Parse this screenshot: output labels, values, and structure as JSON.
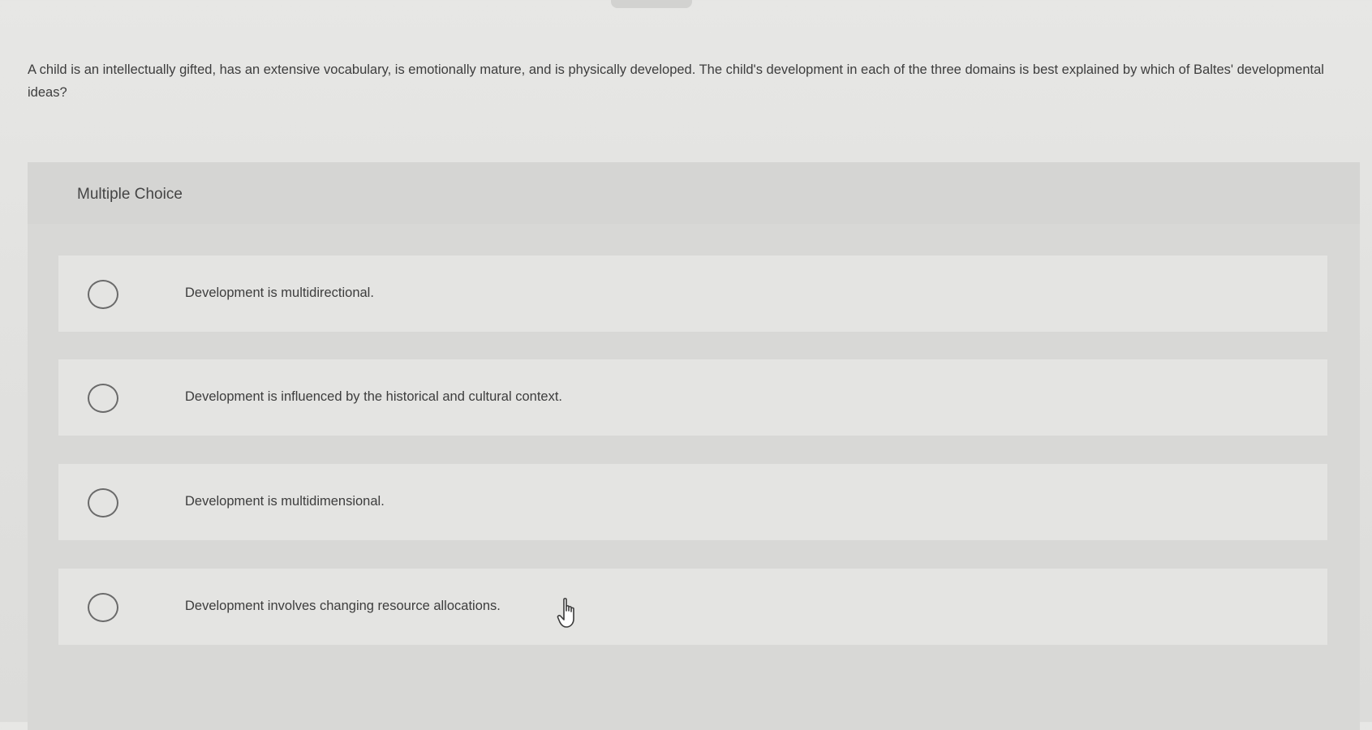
{
  "question": {
    "text": "A child is an intellectually gifted, has an extensive vocabulary, is emotionally mature, and is physically developed. The child's development in each of the three domains is best explained by which of Baltes' developmental ideas?"
  },
  "multiple_choice": {
    "label": "Multiple Choice",
    "options": [
      {
        "label": "Development is multidirectional."
      },
      {
        "label": "Development is influenced by the historical and cultural context."
      },
      {
        "label": "Development is multidimensional."
      },
      {
        "label": "Development involves changing resource allocations."
      }
    ]
  },
  "cursor": {
    "icon": "hand-pointer-icon"
  }
}
